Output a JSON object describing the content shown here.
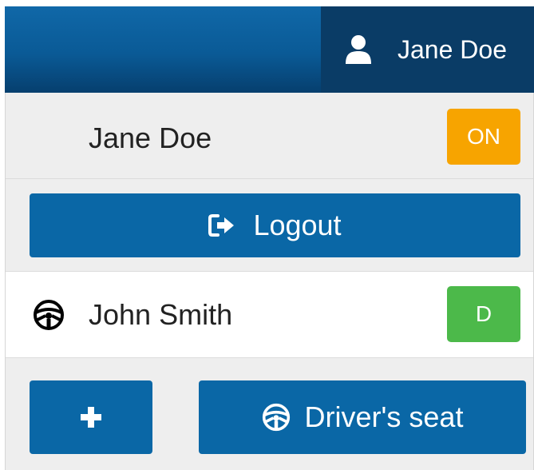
{
  "navbar": {
    "user_name": "Jane Doe",
    "user_icon": "user-icon"
  },
  "dropdown": {
    "current_user": {
      "name": "Jane Doe",
      "status": "ON",
      "status_color": "#f7a400"
    },
    "logout": {
      "label": "Logout",
      "icon": "sign-out-icon"
    },
    "driver": {
      "name": "John Smith",
      "icon": "steering-wheel-icon",
      "badge": "D",
      "badge_color": "#4cb94a"
    },
    "actions": {
      "add_icon": "plus-icon",
      "drivers_seat_label": "Driver's seat",
      "drivers_seat_icon": "steering-wheel-icon"
    }
  },
  "colors": {
    "primary": "#0a67a6",
    "navbar_dark": "#0a3c66",
    "panel_bg": "#eeeeee"
  }
}
